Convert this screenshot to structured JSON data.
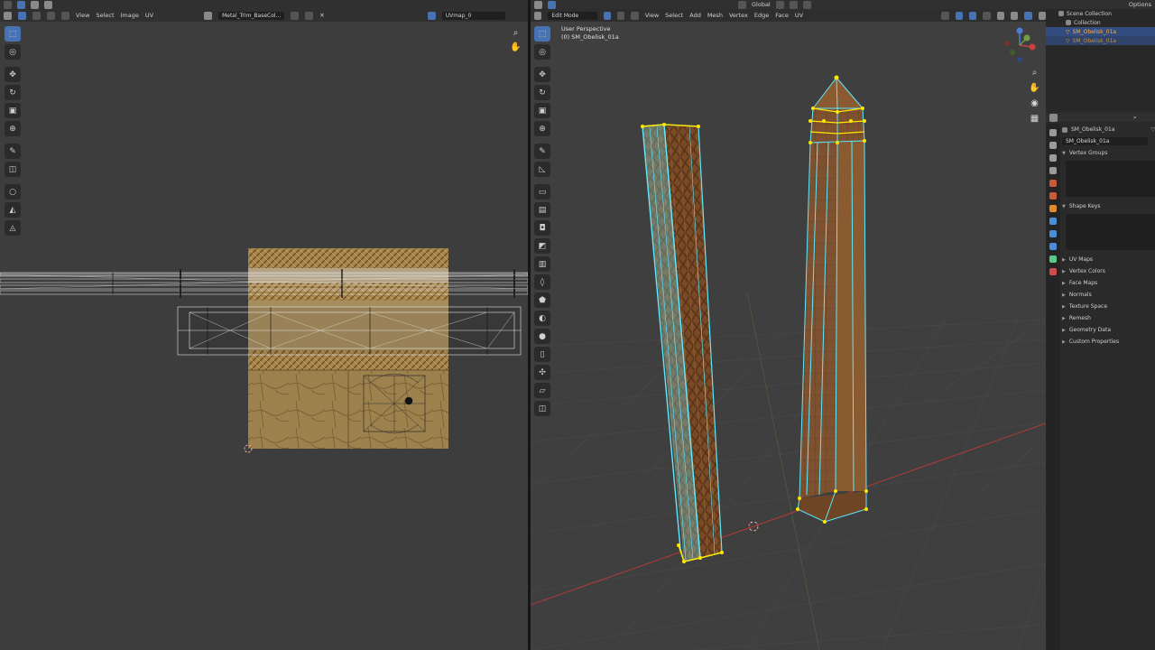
{
  "uv_editor": {
    "header_icons": [
      "editor-type-icon",
      "sync-select-icon",
      "vertex-mode-icon",
      "edge-mode-icon",
      "face-mode-icon",
      "island-mode-icon"
    ],
    "menus": [
      "View",
      "Select",
      "Image",
      "UV"
    ],
    "image_name": "Metal_Trim_BaseCol...",
    "uvmap_label": "UVmap_0"
  },
  "viewport": {
    "mode": "Edit Mode",
    "menus": [
      "View",
      "Select",
      "Add",
      "Mesh",
      "Vertex",
      "Edge",
      "Face",
      "UV"
    ],
    "orientation": "Global",
    "view_name": "User Perspective",
    "object_label": "(0) SM_Obelisk_01a"
  },
  "outliner": {
    "options": "Options",
    "scene_collection": "Scene Collection",
    "collection": "Collection",
    "objects": [
      "SM_Obelisk_01a",
      "SM_Obelisk_01a"
    ]
  },
  "properties": {
    "object": "SM_Obelisk_01a",
    "mesh": "SM_Obelisk_01a",
    "panels": {
      "vertex_groups": "Vertex Groups",
      "shape_keys": "Shape Keys",
      "collapsed": [
        "UV Maps",
        "Vertex Colors",
        "Face Maps",
        "Normals",
        "Texture Space",
        "Remesh",
        "Geometry Data",
        "Custom Properties"
      ]
    }
  },
  "colors": {
    "accent": "#4772b3",
    "wire_selected": "#5ee8ff",
    "vertex_selected": "#ffe600",
    "x_axis": "#b23a3a",
    "texture": "#7a4a26"
  }
}
